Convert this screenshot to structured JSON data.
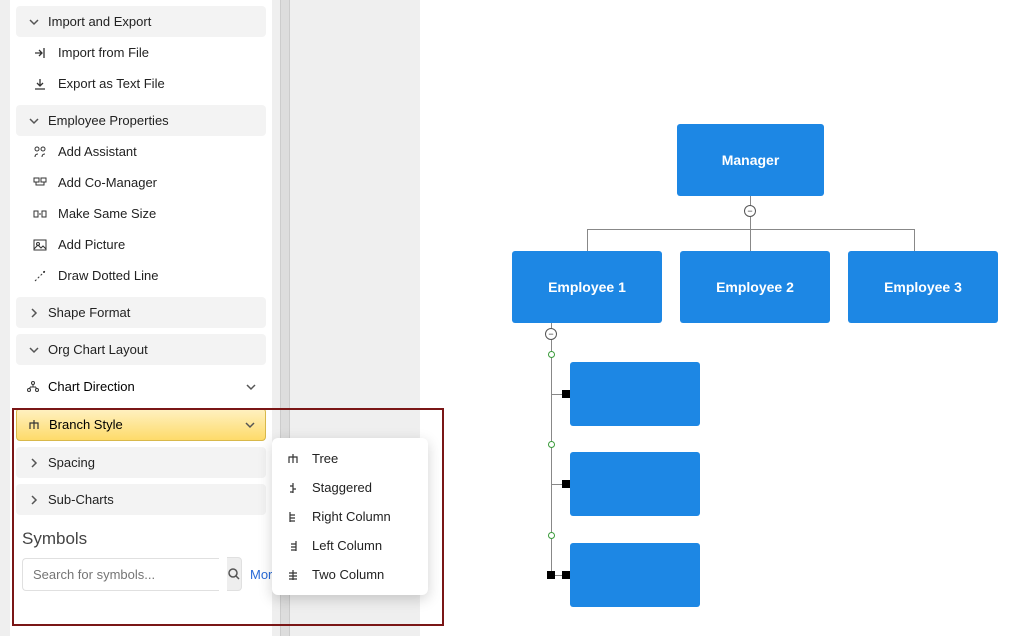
{
  "sections": {
    "import_export": "Import and Export",
    "employee_props": "Employee Properties",
    "shape_format": "Shape Format",
    "org_layout": "Org Chart Layout"
  },
  "items": {
    "import_file": "Import from File",
    "export_text": "Export as Text File",
    "add_assistant": "Add Assistant",
    "add_comanager": "Add Co-Manager",
    "same_size": "Make Same Size",
    "add_picture": "Add Picture",
    "dotted_line": "Draw Dotted Line",
    "chart_direction": "Chart Direction",
    "branch_style": "Branch Style",
    "spacing": "Spacing",
    "subcharts": "Sub-Charts"
  },
  "branch_options": {
    "tree": "Tree",
    "staggered": "Staggered",
    "right_col": "Right Column",
    "left_col": "Left Column",
    "two_col": "Two Column"
  },
  "symbols": {
    "title": "Symbols",
    "placeholder": "Search for symbols...",
    "more": "More"
  },
  "chart_data": {
    "type": "org-chart",
    "root": "Manager",
    "level1": [
      "Employee 1",
      "Employee 2",
      "Employee 3"
    ],
    "employee1_children_count": 3
  },
  "nodes": {
    "manager": "Manager",
    "e1": "Employee 1",
    "e2": "Employee 2",
    "e3": "Employee 3"
  }
}
